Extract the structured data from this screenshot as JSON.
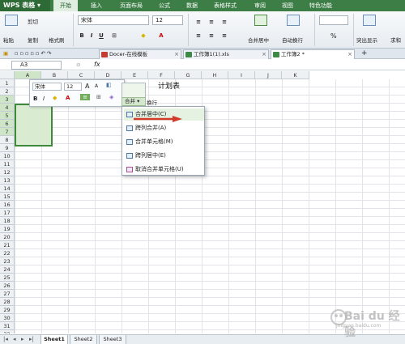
{
  "app": {
    "brand": "WPS 表格",
    "accent": "#3c7e46"
  },
  "menu": [
    "开始",
    "插入",
    "页面布局",
    "公式",
    "数据",
    "表格样式",
    "审阅",
    "视图",
    "特色功能"
  ],
  "ribbon": {
    "cut": "剪切",
    "paste": "粘贴",
    "copy": "复制",
    "format_painter": "格式刷",
    "font": "宋体",
    "size": "12",
    "bold": "B",
    "italic": "I",
    "underline": "U",
    "merge_center": "合并居中",
    "auto_wrap": "自动换行",
    "percent": "%",
    "highlight": "突出显示",
    "sum": "求和"
  },
  "doc_tabs": [
    {
      "label": "Docer-在线模板"
    },
    {
      "label": "工作簿1(1).xls"
    },
    {
      "label": "工作簿2 *"
    }
  ],
  "formula": {
    "cell_ref": "A3",
    "fx": "fx"
  },
  "grid": {
    "columns": [
      "A",
      "B",
      "C",
      "D",
      "E",
      "F",
      "G",
      "H",
      "I",
      "J",
      "K"
    ],
    "rows": [
      "1",
      "2",
      "3",
      "4",
      "5",
      "6",
      "7",
      "8",
      "9",
      "10",
      "11",
      "12",
      "13",
      "14",
      "15",
      "16",
      "17",
      "18",
      "19",
      "20",
      "21",
      "22",
      "23",
      "24",
      "25",
      "26",
      "27",
      "28",
      "29",
      "30",
      "31",
      "32"
    ],
    "title_text": "计划表"
  },
  "floating_toolbar": {
    "font": "宋体",
    "size": "12",
    "grow": "A",
    "shrink": "A",
    "bold": "B",
    "italic": "I",
    "merge": "合并",
    "wrap": "换行"
  },
  "merge_menu": [
    "合并居中(C)",
    "跨列合并(A)",
    "合并单元格(M)",
    "跨列居中(E)",
    "取消合并单元格(U)"
  ],
  "sheets": [
    "Sheet1",
    "Sheet2",
    "Sheet3"
  ],
  "watermark": {
    "text": "Bai du 经验",
    "url": "jingyan.baidu.com"
  }
}
